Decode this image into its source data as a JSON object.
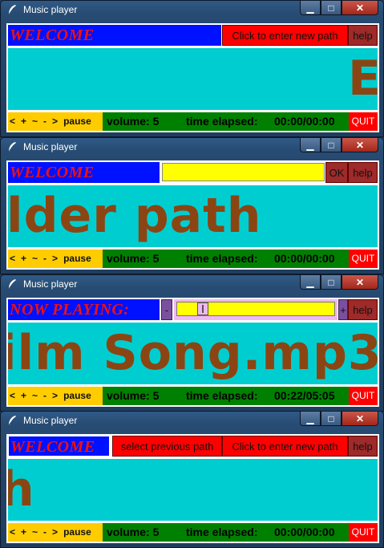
{
  "window_title": "Music player",
  "controls": {
    "minimize": "▁",
    "maximize": "□",
    "close": "✕"
  },
  "bottom": {
    "prev": "<",
    "vol_up": "+",
    "loop": "~",
    "vol_down": "-",
    "next": ">",
    "pause": "pause",
    "volume_label": "volume: 5",
    "elapsed_label": "time elapsed:",
    "quit": "QUIT"
  },
  "win1": {
    "status": "WELCOME",
    "enter_path": "Click to enter new path",
    "help": "help",
    "marquee": "En",
    "elapsed": "00:00/00:00"
  },
  "win2": {
    "status": "WELCOME",
    "ok": "OK",
    "help": "help",
    "marquee": "lder path",
    "elapsed": "00:00/00:00"
  },
  "win3": {
    "status": "NOW PLAYING:",
    "minus": "-",
    "plus": "+",
    "help": "help",
    "marquee": "ilm Song.mp3",
    "elapsed": "00:22/05:05",
    "progress": 0.07
  },
  "win4": {
    "status": "WELCOME",
    "prev_path": "select previous path",
    "enter_path": "Click to enter new path",
    "help": "help",
    "marquee": "h",
    "elapsed": "00:00/00:00"
  },
  "colors": {
    "status_bg": "#0011ff",
    "status_text": "#ee1111",
    "display_bg": "#00cdd0",
    "marquee": "#8b4513",
    "controls_bg": "#ffcc00",
    "volume_bg": "#008000",
    "quit_bg": "#ff0000"
  }
}
